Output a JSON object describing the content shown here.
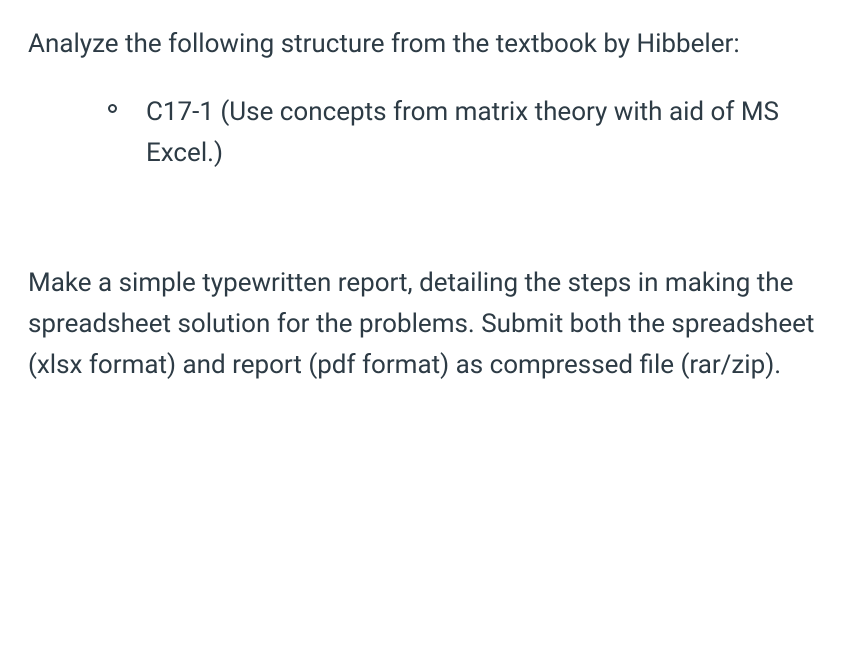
{
  "intro": "Analyze the following structure from the textbook by Hibbeler:",
  "list": {
    "items": [
      "C17-1 (Use concepts from matrix theory with aid of MS Excel.)"
    ]
  },
  "closing": "Make a simple typewritten report, detailing the steps in making the spreadsheet solution for the problems. Submit both the spreadsheet (xlsx format) and report (pdf format) as compressed file (rar/zip)."
}
